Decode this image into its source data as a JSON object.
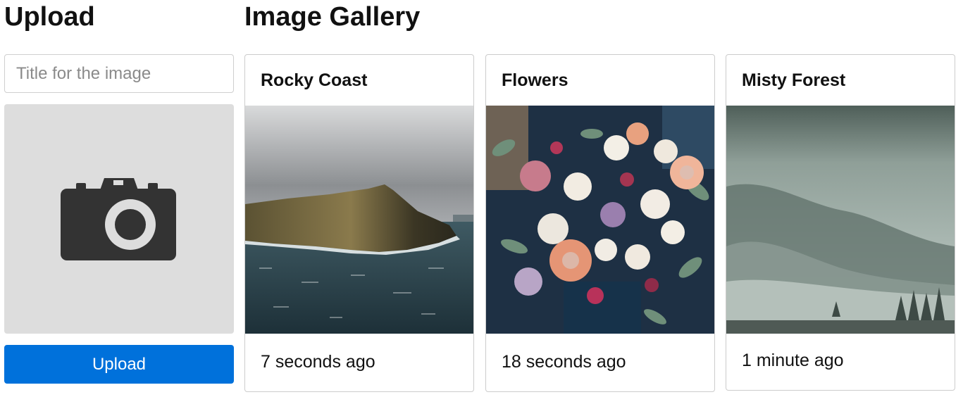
{
  "upload": {
    "heading": "Upload",
    "title_placeholder": "Title for the image",
    "title_value": "",
    "dropzone_icon": "camera-icon",
    "button_label": "Upload",
    "button_color": "#0071db"
  },
  "gallery": {
    "heading": "Image Gallery",
    "cards": [
      {
        "title": "Rocky Coast",
        "time": "7 seconds ago",
        "image_icon": "rocky-coast-photo"
      },
      {
        "title": "Flowers",
        "time": "18 seconds ago",
        "image_icon": "flower-bouquet-photo"
      },
      {
        "title": "Misty Forest",
        "time": "1 minute ago",
        "image_icon": "misty-forest-photo"
      }
    ]
  }
}
